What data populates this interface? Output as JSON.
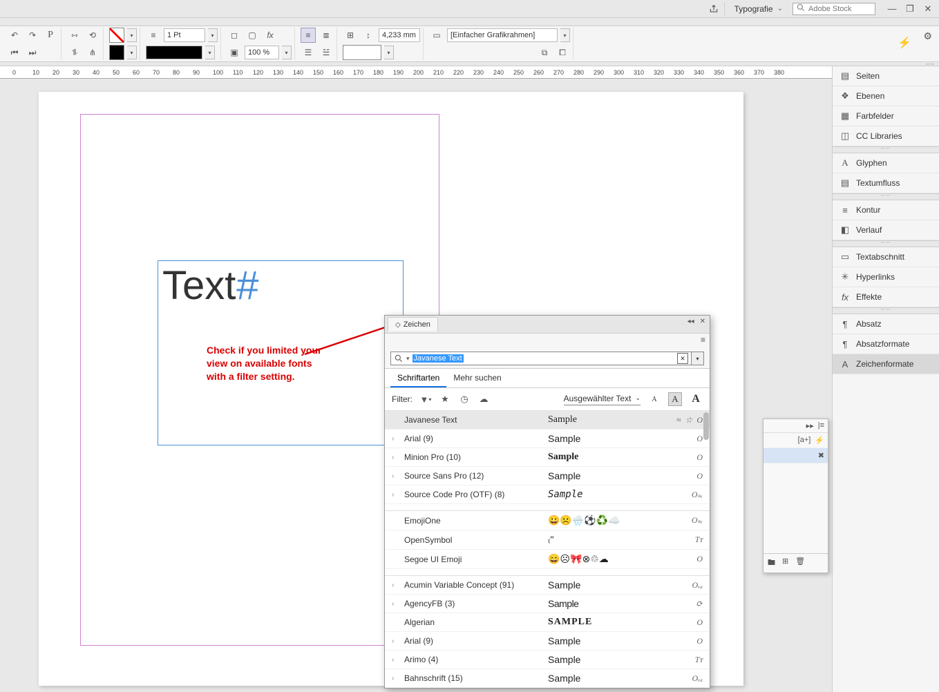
{
  "window": {
    "workspace": "Typografie",
    "stock_placeholder": "Adobe Stock"
  },
  "toolbar": {
    "stroke_weight": "1 Pt",
    "scale": "100 %",
    "dimension_value": "4,233 mm",
    "frame_type": "[Einfacher Grafikrahmen]"
  },
  "ruler_ticks": [
    "0",
    "10",
    "20",
    "30",
    "40",
    "50",
    "60",
    "70",
    "80",
    "90",
    "100",
    "110",
    "120",
    "130",
    "140",
    "150",
    "160",
    "170",
    "180",
    "190",
    "200",
    "210",
    "220",
    "230",
    "240",
    "250",
    "260",
    "270",
    "280",
    "290",
    "300",
    "310",
    "320",
    "330",
    "340",
    "350",
    "360",
    "370",
    "380"
  ],
  "document": {
    "sample_text": "Text",
    "hash": "#",
    "annotation": "Check if you limited your view on available fonts with a filter setting."
  },
  "side_panels": {
    "seiten": "Seiten",
    "ebenen": "Ebenen",
    "farbfelder": "Farbfelder",
    "cclib": "CC Libraries",
    "glyphen": "Glyphen",
    "textumfluss": "Textumfluss",
    "kontur": "Kontur",
    "verlauf": "Verlauf",
    "textabschnitt": "Textabschnitt",
    "hyperlinks": "Hyperlinks",
    "effekte": "Effekte",
    "absatz": "Absatz",
    "absatzformate": "Absatzformate",
    "zeichenformate": "Zeichenformate"
  },
  "char_panel": {
    "title": "Zeichen",
    "search_value": "Javanese Text",
    "tab_fonts": "Schriftarten",
    "tab_more": "Mehr suchen",
    "filter_label": "Filter:",
    "sample_sel_label": "Ausgewählter Text"
  },
  "fonts": {
    "recent": [
      {
        "name": "Javanese Text",
        "sample": "Sample",
        "style": "serif-italicish",
        "icons": [
          "≈",
          "☆",
          "O"
        ],
        "hl": true,
        "exp": false
      },
      {
        "name": "Arial (9)",
        "sample": "Sample",
        "style": "sans",
        "icons": [
          "O"
        ],
        "exp": true
      },
      {
        "name": "Minion Pro (10)",
        "sample": "Sample",
        "style": "serif-bold",
        "icons": [
          "O"
        ],
        "exp": true
      },
      {
        "name": "Source Sans Pro (12)",
        "sample": "Sample",
        "style": "sans",
        "icons": [
          "O"
        ],
        "exp": true
      },
      {
        "name": "Source Code Pro (OTF) (8)",
        "sample": "Sample",
        "style": "mono-italic",
        "icons": [
          "Oₛᵥ"
        ],
        "exp": true
      }
    ],
    "emoji": [
      {
        "name": "EmojiOne",
        "sample": "😀☹️🌧️⚽♻️☁️",
        "icons": [
          "Oₛᵥ"
        ]
      },
      {
        "name": "OpenSymbol",
        "sample": "₍\"",
        "icons": [
          "Tᴛ"
        ]
      },
      {
        "name": "Segoe UI Emoji",
        "sample": "😄☹🎀⊗♲☁",
        "icons": [
          "O"
        ]
      }
    ],
    "all": [
      {
        "name": "Acumin Variable Concept (91)",
        "sample": "Sample",
        "style": "sans",
        "icons": [
          "Oᵥₐ"
        ],
        "exp": true
      },
      {
        "name": "AgencyFB (3)",
        "sample": "Sample",
        "style": "cond",
        "icons": [
          "⟳"
        ],
        "exp": true
      },
      {
        "name": "Algerian",
        "sample": "SAMPLE",
        "style": "display",
        "icons": [
          "O"
        ],
        "exp": false
      },
      {
        "name": "Arial (9)",
        "sample": "Sample",
        "style": "sans",
        "icons": [
          "O"
        ],
        "exp": true
      },
      {
        "name": "Arimo (4)",
        "sample": "Sample",
        "style": "sans",
        "icons": [
          "Tᴛ"
        ],
        "exp": true
      },
      {
        "name": "Bahnschrift (15)",
        "sample": "Sample",
        "style": "sans",
        "icons": [
          "Oᵥₐ"
        ],
        "exp": true
      }
    ]
  }
}
